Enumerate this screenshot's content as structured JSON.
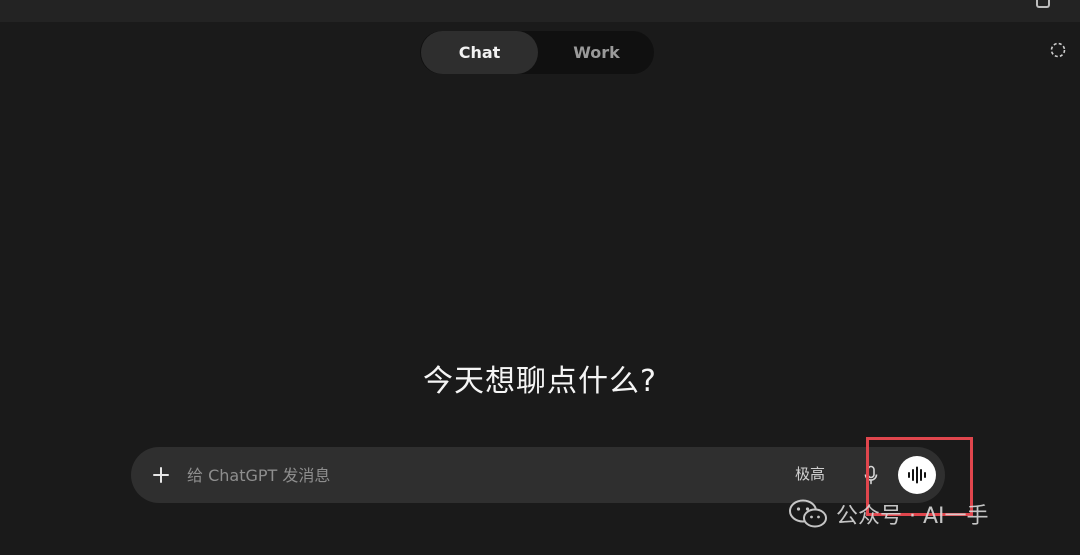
{
  "mode_switch": {
    "chat_label": "Chat",
    "work_label": "Work",
    "active": "chat"
  },
  "icons": {
    "temporary_chat": "dashed-circle-icon",
    "add": "plus-icon",
    "mic": "mic-icon",
    "voice": "waveform-icon",
    "wechat": "wechat-icon"
  },
  "greeting": "今天想聊点什么?",
  "composer": {
    "placeholder": "给 ChatGPT 发消息",
    "value": "",
    "model_label": "极高"
  },
  "watermark": {
    "text": "公众号 · AI一手"
  },
  "colors": {
    "background": "#1a1a1a",
    "composer": "#2f2f2f",
    "highlight": "#e0464d"
  }
}
